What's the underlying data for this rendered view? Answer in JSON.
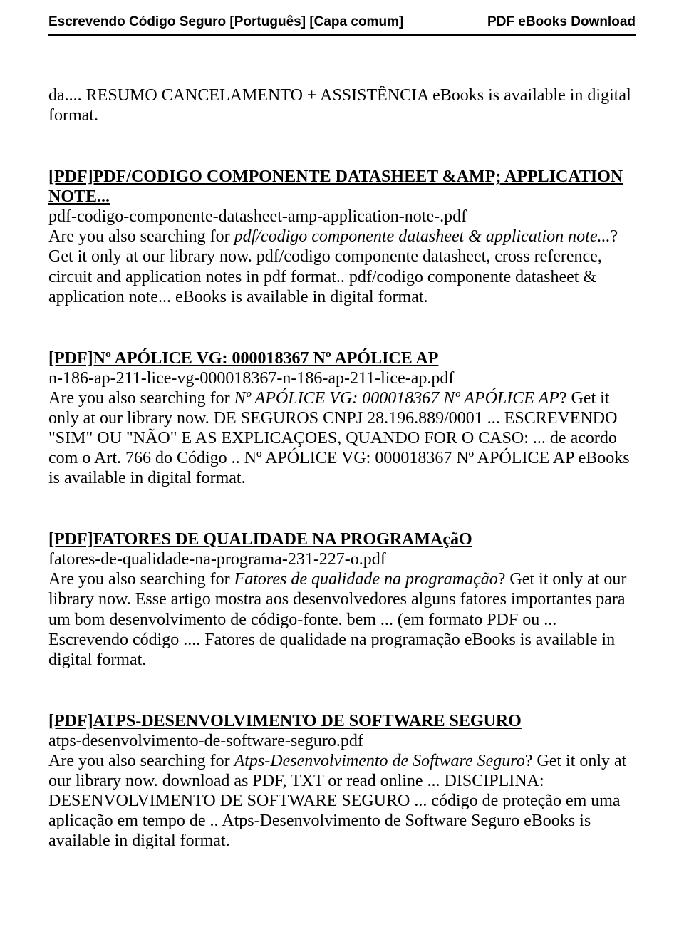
{
  "header": {
    "left": "Escrevendo Código Seguro [Português]  [Capa comum]",
    "right": "PDF eBooks Download"
  },
  "intro": "da.... RESUMO CANCELAMENTO + ASSISTÊNCIA eBooks is available in digital format.",
  "sections": [
    {
      "title": "[PDF]PDF/CODIGO COMPONENTE DATASHEET &AMP; APPLICATION NOTE...",
      "filename": "pdf-codigo-componente-datasheet-amp-application-note-.pdf",
      "body_pre": "Are you also searching for ",
      "body_italic": "pdf/codigo componente datasheet & application note...",
      "body_post": "? Get it only at our library now. pdf/codigo componente datasheet, cross reference, circuit and application notes in pdf format.. pdf/codigo componente datasheet & application note... eBooks is available in digital format."
    },
    {
      "title": "[PDF]Nº APÓLICE VG: 000018367 Nº APÓLICE AP",
      "filename": "n-186-ap-211-lice-vg-000018367-n-186-ap-211-lice-ap.pdf",
      "body_pre": "Are you also searching for ",
      "body_italic": "Nº APÓLICE VG: 000018367 Nº APÓLICE AP",
      "body_post": "? Get it only at our library now. DE SEGUROS CNPJ 28.196.889/0001 ... ESCREVENDO \"SIM\" OU \"NÃO\" E AS EXPLICAÇOES, QUANDO FOR O CASO: ... de acordo com o Art. 766 do Código .. Nº APÓLICE VG: 000018367 Nº APÓLICE AP eBooks is available in digital format."
    },
    {
      "title": "[PDF]FATORES DE QUALIDADE NA PROGRAMAçãO",
      "filename": "fatores-de-qualidade-na-programa-231-227-o.pdf",
      "body_pre": "Are you also searching for ",
      "body_italic": "Fatores de qualidade na programação",
      "body_post": "? Get it only at our library now. Esse artigo mostra aos desenvolvedores alguns fatores importantes para um bom desenvolvimento de código-fonte. bem ... (em formato PDF ou ... Escrevendo código .... Fatores de qualidade na programação eBooks is available in digital format."
    },
    {
      "title": "[PDF]ATPS-DESENVOLVIMENTO DE SOFTWARE SEGURO",
      "filename": "atps-desenvolvimento-de-software-seguro.pdf",
      "body_pre": "Are you also searching for ",
      "body_italic": "Atps-Desenvolvimento de Software Seguro",
      "body_post": "? Get it only at our library now. download as PDF, TXT or read online ... DISCIPLINA: DESENVOLVIMENTO DE SOFTWARE SEGURO ... código de proteção em uma aplicação em tempo de .. Atps-Desenvolvimento de Software Seguro eBooks is available in digital format."
    }
  ]
}
